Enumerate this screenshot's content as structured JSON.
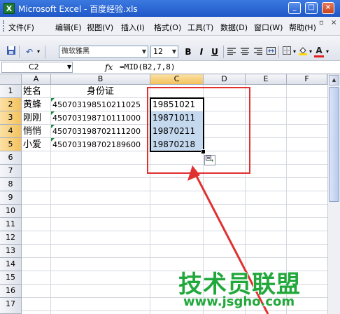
{
  "window": {
    "title": "Microsoft Excel - 百度经验.xls",
    "app_icon": "X"
  },
  "menu": {
    "items": [
      "文件(F)",
      "编辑(E)",
      "视图(V)",
      "插入(I)",
      "格式(O)",
      "工具(T)",
      "数据(D)",
      "窗口(W)",
      "帮助(H)"
    ]
  },
  "toolbar": {
    "font_name": "微软雅黑",
    "font_size": "12",
    "bold": "B",
    "italic": "I",
    "underline": "U",
    "font_color_glyph": "A"
  },
  "formula_bar": {
    "name_box": "C2",
    "fx": "fx",
    "formula": "=MID(B2,7,8)"
  },
  "grid": {
    "columns": [
      "A",
      "B",
      "C",
      "D",
      "E",
      "F"
    ],
    "rows": [
      "1",
      "2",
      "3",
      "4",
      "5",
      "6",
      "7",
      "8",
      "9",
      "10",
      "11",
      "12",
      "13",
      "14",
      "15",
      "16",
      "17"
    ],
    "header": {
      "name": "姓名",
      "id": "身份证"
    },
    "records": [
      {
        "name": "黄蜂",
        "id": "450703198510211025",
        "birth": "19851021"
      },
      {
        "name": "刚刚",
        "id": "450703198710111000",
        "birth": "19871011"
      },
      {
        "name": "悄悄",
        "id": "450703198702111200",
        "birth": "19870211"
      },
      {
        "name": "小爱",
        "id": "450703198702189600",
        "birth": "19870218"
      }
    ]
  },
  "watermark": {
    "text": "技术员联盟",
    "url": "www.jsgho.com"
  },
  "colors": {
    "highlight": "#c5d9ee",
    "annotation_red": "#e03030",
    "watermark_green": "#21a83b"
  }
}
